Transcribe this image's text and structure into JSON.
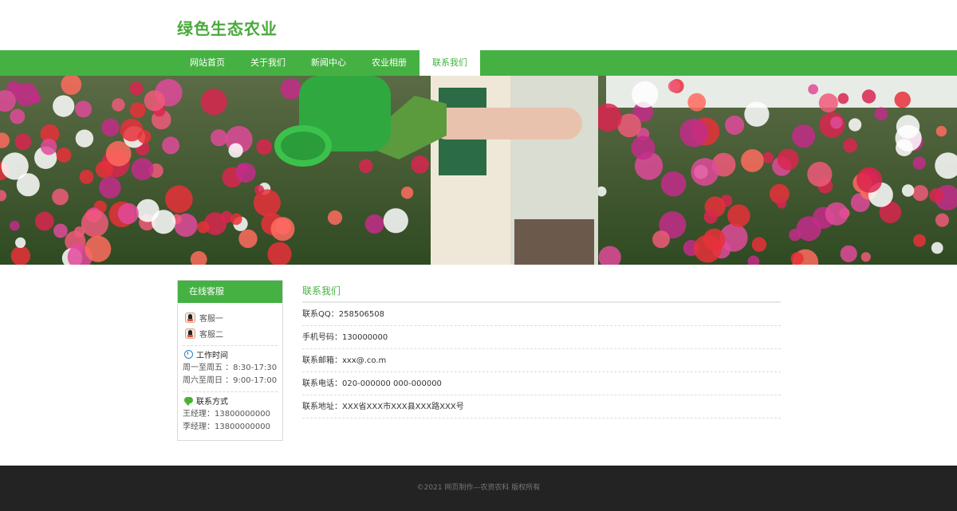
{
  "site": {
    "logo": "绿色生态农业"
  },
  "nav": {
    "items": [
      {
        "label": "网站首页"
      },
      {
        "label": "关于我们"
      },
      {
        "label": "新闻中心"
      },
      {
        "label": "农业相册"
      },
      {
        "label": "联系我们"
      }
    ],
    "active_index": 4
  },
  "colors": {
    "brand": "#46b143",
    "footer_bg": "#232323"
  },
  "sidebar": {
    "title": "在线客服",
    "services": [
      {
        "label": "客服一"
      },
      {
        "label": "客服二"
      }
    ],
    "hours": {
      "title": "工作时间",
      "lines": [
        "周一至周五 ：8:30-17:30",
        "周六至周日 ：9:00-17:00"
      ]
    },
    "contact": {
      "title": "联系方式",
      "lines": [
        "王经理：13800000000",
        "李经理：13800000000"
      ]
    }
  },
  "main": {
    "title": "联系我们",
    "rows": [
      "联系QQ：258506508",
      "手机号码：130000000",
      "联系邮箱：xxx@.co.m",
      "联系电话：020-000000 000-000000",
      "联系地址：XXX省XXX市XXX县XXX路XXX号"
    ]
  },
  "footer": {
    "text": "©2021 网页制作—农资农科 版权所有"
  }
}
